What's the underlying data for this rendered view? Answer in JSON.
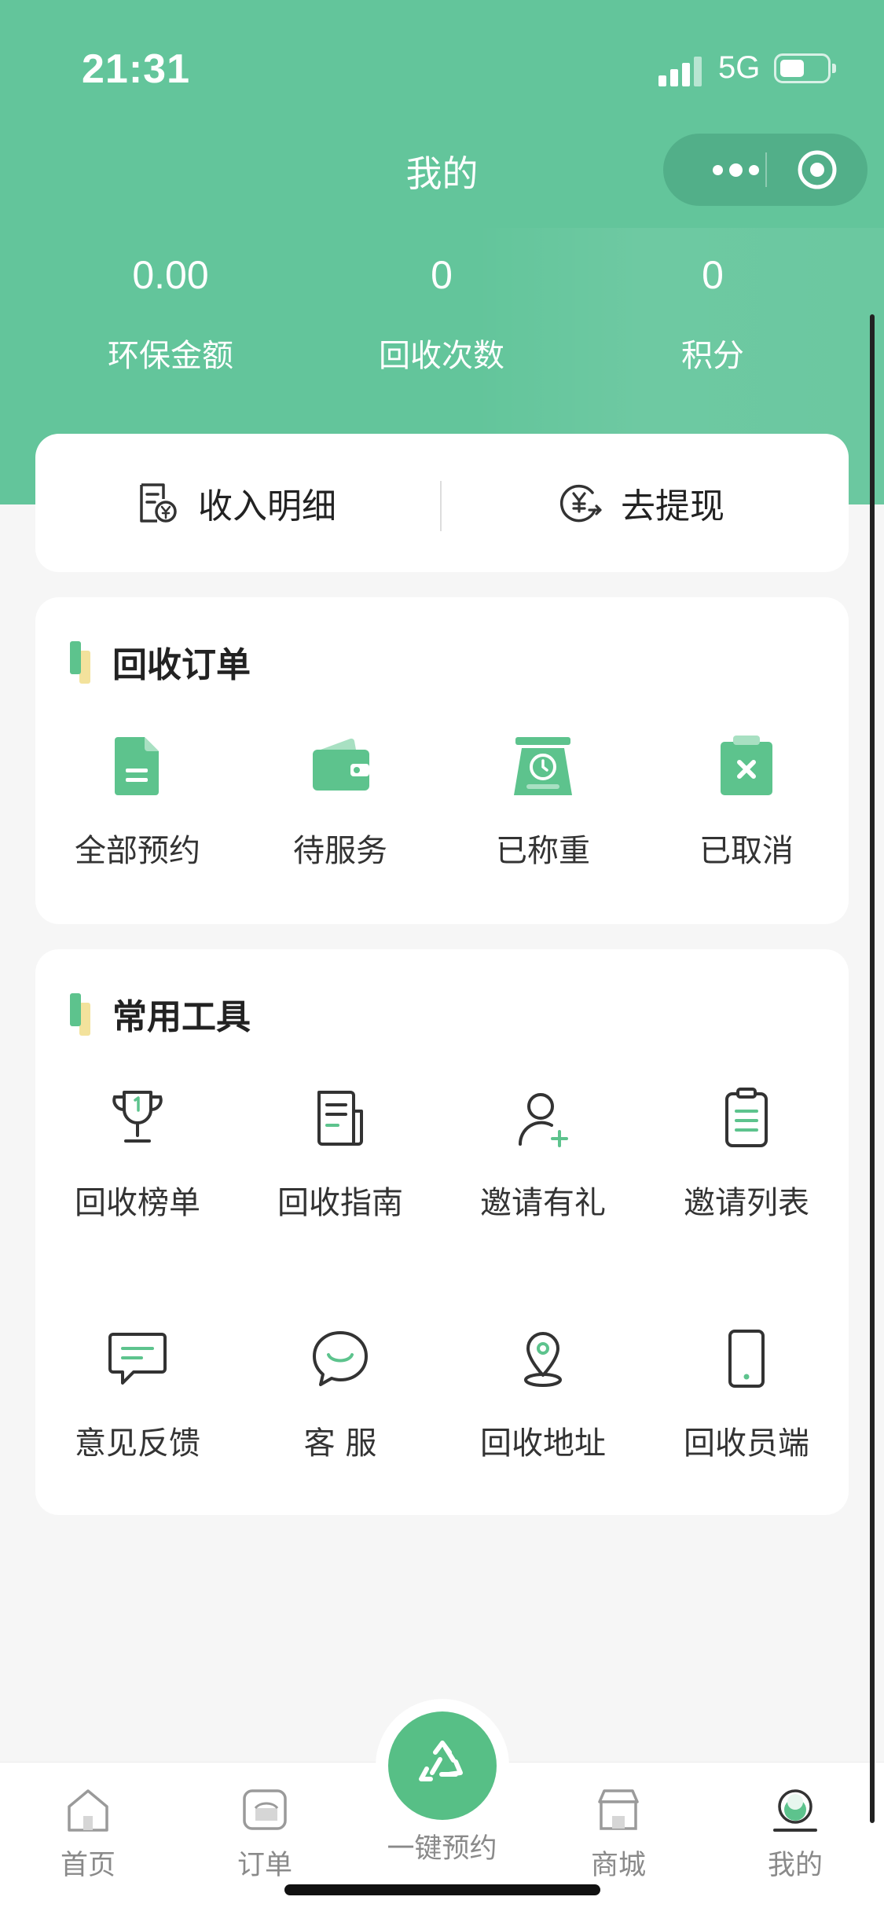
{
  "status_bar": {
    "time": "21:31",
    "network": "5G"
  },
  "nav": {
    "title": "我的"
  },
  "stats": [
    {
      "value": "0.00",
      "label": "环保金额"
    },
    {
      "value": "0",
      "label": "回收次数"
    },
    {
      "value": "0",
      "label": "积分"
    }
  ],
  "income": {
    "detail_label": "收入明细",
    "withdraw_label": "去提现"
  },
  "orders": {
    "title": "回收订单",
    "items": [
      {
        "label": "全部预约",
        "icon": "document-icon"
      },
      {
        "label": "待服务",
        "icon": "wallet-icon"
      },
      {
        "label": "已称重",
        "icon": "scale-icon"
      },
      {
        "label": "已取消",
        "icon": "cancel-clipboard-icon"
      }
    ]
  },
  "tools": {
    "title": "常用工具",
    "items": [
      {
        "label": "回收榜单",
        "icon": "trophy-icon"
      },
      {
        "label": "回收指南",
        "icon": "guide-icon"
      },
      {
        "label": "邀请有礼",
        "icon": "invite-user-icon"
      },
      {
        "label": "邀请列表",
        "icon": "clipboard-list-icon"
      },
      {
        "label": "意见反馈",
        "icon": "feedback-icon"
      },
      {
        "label": "客 服",
        "icon": "customer-service-icon"
      },
      {
        "label": "回收地址",
        "icon": "location-icon"
      },
      {
        "label": "回收员端",
        "icon": "phone-icon"
      }
    ]
  },
  "tabbar": {
    "items": [
      {
        "label": "首页",
        "icon": "home-icon"
      },
      {
        "label": "订单",
        "icon": "orders-icon"
      },
      {
        "label": "一键预约",
        "icon": "recycle-icon"
      },
      {
        "label": "商城",
        "icon": "store-icon"
      },
      {
        "label": "我的",
        "icon": "profile-icon"
      }
    ]
  },
  "colors": {
    "primary": "#63c59b",
    "accent": "#57bf86",
    "highlight": "#f3e29c"
  }
}
